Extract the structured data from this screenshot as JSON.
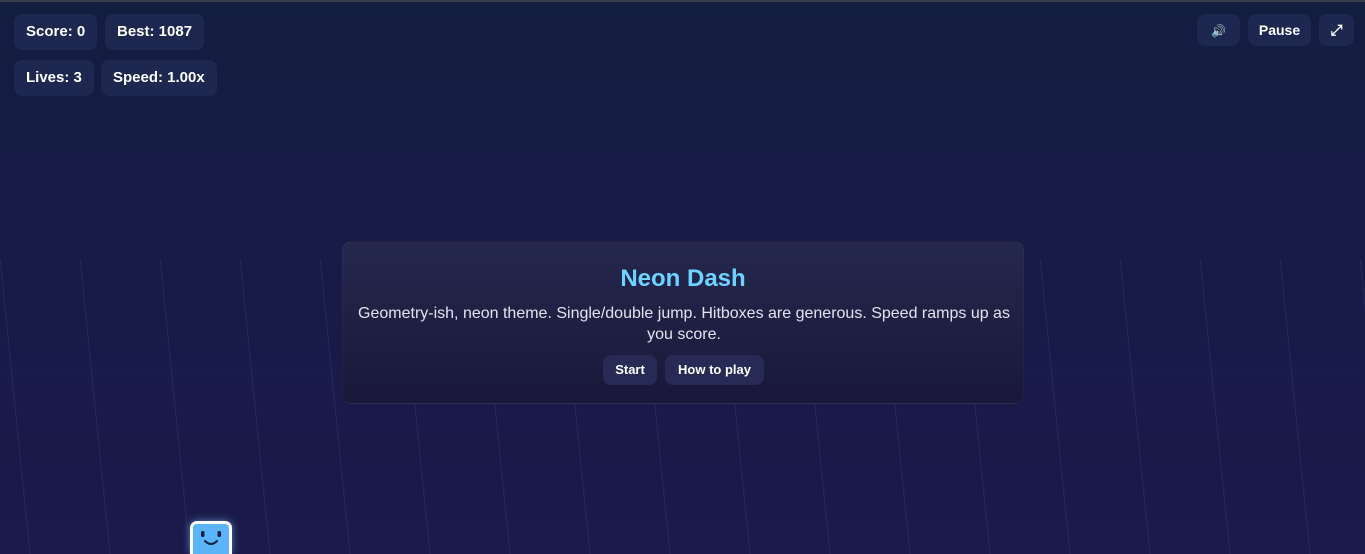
{
  "hud": {
    "score": "Score: 0",
    "best": "Best: 1087",
    "lives": "Lives: 3",
    "speed": "Speed: 1.00x"
  },
  "controls": {
    "sound_icon": "speaker-icon",
    "sound_glyph": "🔊",
    "pause_label": "Pause",
    "fullscreen_icon": "expand-icon",
    "fullscreen_glyph": "⤢"
  },
  "menu": {
    "title": "Neon Dash",
    "description": "Geometry-ish, neon theme. Single/double jump. Hitboxes are generous. Speed ramps up as you score.",
    "start_label": "Start",
    "howto_label": "How to play"
  },
  "colors": {
    "accent": "#6fd3ff",
    "player": "#5ab4f7",
    "chip_bg": "#1e2750"
  }
}
